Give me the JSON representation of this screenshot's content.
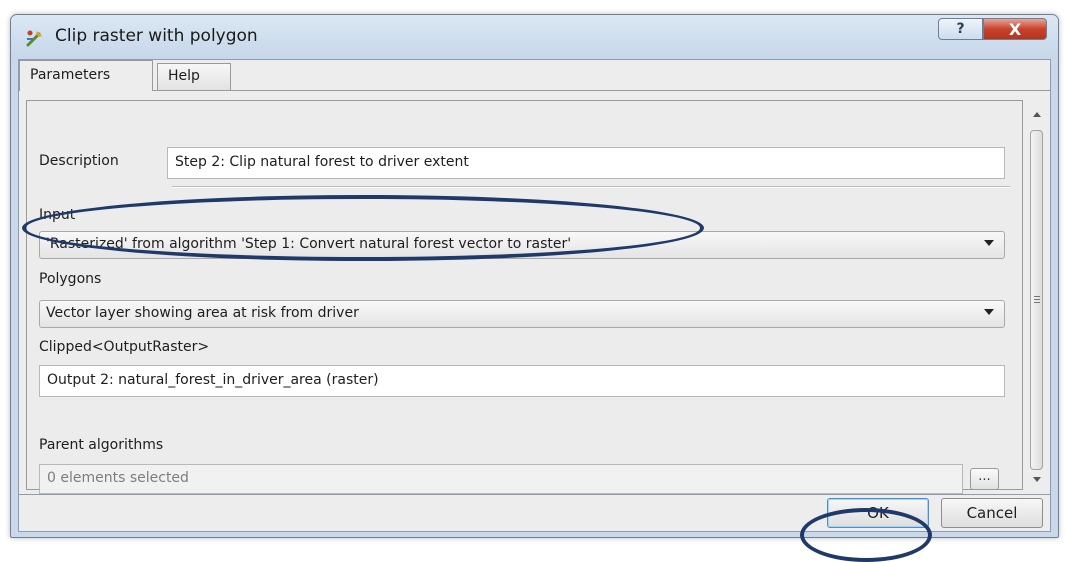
{
  "window": {
    "title": "Clip raster with polygon",
    "help_glyph": "?",
    "close_glyph": "X"
  },
  "tabs": [
    {
      "label": "Parameters"
    },
    {
      "label": "Help"
    }
  ],
  "form": {
    "description_label": "Description",
    "description_value": "Step 2: Clip natural forest to driver extent",
    "input_label": "Input",
    "input_value": "'Rasterized' from algorithm 'Step 1: Convert natural forest vector to raster'",
    "polygons_label": "Polygons",
    "polygons_value": "Vector layer showing area at risk from driver",
    "clipped_label": "Clipped<OutputRaster>",
    "clipped_value": "Output 2: natural_forest_in_driver_area (raster)",
    "parent_label": "Parent algorithms",
    "parent_value": "0 elements selected",
    "dots_label": "..."
  },
  "buttons": {
    "ok": "OK",
    "cancel": "Cancel"
  },
  "annotation_color": "#1f3a6a"
}
